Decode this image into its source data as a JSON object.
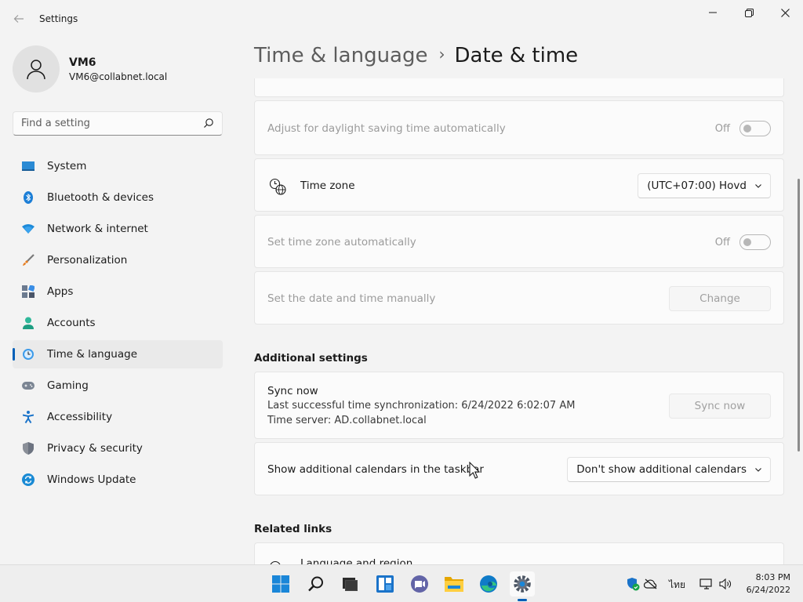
{
  "window": {
    "title": "Settings",
    "controls": {
      "minimize": "minimize",
      "maximize": "maximize",
      "close": "close"
    }
  },
  "profile": {
    "name": "VM6",
    "email": "VM6@collabnet.local"
  },
  "search": {
    "placeholder": "Find a setting",
    "value": ""
  },
  "nav": {
    "items": [
      {
        "label": "System",
        "icon": "system-icon"
      },
      {
        "label": "Bluetooth & devices",
        "icon": "bluetooth-icon"
      },
      {
        "label": "Network & internet",
        "icon": "wifi-icon"
      },
      {
        "label": "Personalization",
        "icon": "brush-icon"
      },
      {
        "label": "Apps",
        "icon": "apps-icon"
      },
      {
        "label": "Accounts",
        "icon": "accounts-icon"
      },
      {
        "label": "Time & language",
        "icon": "clock-globe-icon",
        "active": true
      },
      {
        "label": "Gaming",
        "icon": "gamepad-icon"
      },
      {
        "label": "Accessibility",
        "icon": "accessibility-icon"
      },
      {
        "label": "Privacy & security",
        "icon": "shield-icon"
      },
      {
        "label": "Windows Update",
        "icon": "update-icon"
      }
    ]
  },
  "breadcrumb": {
    "parent": "Time & language",
    "separator": "›",
    "current": "Date & time"
  },
  "settings": {
    "daylight": {
      "label": "Adjust for daylight saving time automatically",
      "state": "Off"
    },
    "timezone": {
      "label": "Time zone",
      "value": "(UTC+07:00) Hovd"
    },
    "timezone_auto": {
      "label": "Set time zone automatically",
      "state": "Off"
    },
    "manual": {
      "label": "Set the date and time manually",
      "button": "Change"
    }
  },
  "additional": {
    "title": "Additional settings",
    "sync": {
      "title": "Sync now",
      "last_sync": "Last successful time synchronization: 6/24/2022 6:02:07 AM",
      "server": "Time server: AD.collabnet.local",
      "button": "Sync now"
    },
    "calendars": {
      "label": "Show additional calendars in the taskbar",
      "value": "Don't show additional calendars"
    }
  },
  "related": {
    "title": "Related links",
    "first_item": "Language and region"
  },
  "taskbar": {
    "apps": [
      "start-icon",
      "search-icon",
      "task-view-icon",
      "widgets-icon",
      "teams-chat-icon",
      "file-explorer-icon",
      "edge-icon",
      "settings-icon"
    ],
    "tray_lang": "ไทย",
    "time": "8:03 PM",
    "date": "6/24/2022"
  },
  "colors": {
    "accent": "#005fb8",
    "background": "#f3f3f3",
    "card": "#fbfbfb"
  }
}
